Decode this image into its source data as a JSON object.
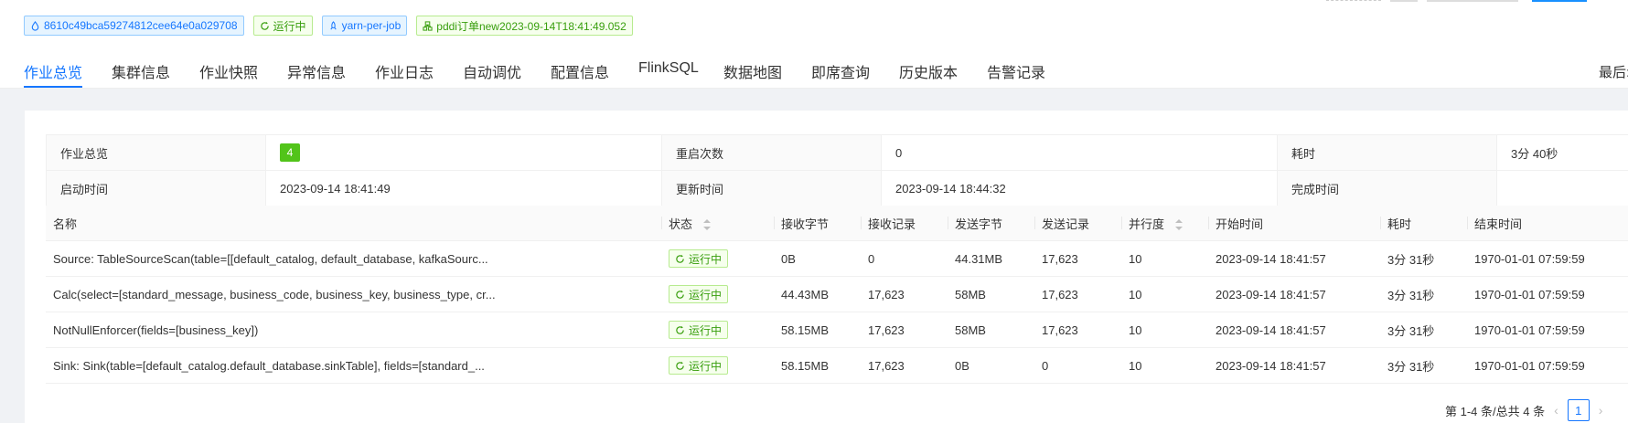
{
  "colors": {
    "accent": "#1677ff",
    "success": "#52c41a",
    "tag_green": "#389e0d"
  },
  "tags": [
    {
      "icon": "drop-icon",
      "text": "8610c49bca59274812cee64e0a029708",
      "style": "blue"
    },
    {
      "icon": "sync-icon",
      "text": "运行中",
      "style": "green"
    },
    {
      "icon": "rocket-icon",
      "text": "yarn-per-job",
      "style": "blue"
    },
    {
      "icon": "cluster-icon",
      "text": "pddi订单new2023-09-14T18:41:49.052",
      "style": "green"
    }
  ],
  "tabs": [
    "作业总览",
    "集群信息",
    "作业快照",
    "异常信息",
    "作业日志",
    "自动调优",
    "配置信息",
    "FlinkSQL",
    "数据地图",
    "即席查询",
    "历史版本",
    "告警记录"
  ],
  "active_tab": "作业总览",
  "tab_right": "最后:",
  "overview": {
    "row1": {
      "l1": "作业总览",
      "v1": "4",
      "l2": "重启次数",
      "v2": "0",
      "l3": "耗时",
      "v3": "3分 40秒"
    },
    "row2": {
      "l1": "启动时间",
      "v1": "2023-09-14 18:41:49",
      "l2": "更新时间",
      "v2": "2023-09-14 18:44:32",
      "l3": "完成时间",
      "v3": ""
    }
  },
  "vertex_table": {
    "columns": [
      "名称",
      "状态",
      "接收字节",
      "接收记录",
      "发送字节",
      "发送记录",
      "并行度",
      "开始时间",
      "耗时",
      "结束时间"
    ],
    "rows": [
      {
        "name": "Source: TableSourceScan(table=[[default_catalog, default_database, kafkaSourc...",
        "status": "运行中",
        "recv_bytes": "0B",
        "recv_records": "0",
        "send_bytes": "44.31MB",
        "send_records": "17,623",
        "parallelism": "10",
        "start": "2023-09-14 18:41:57",
        "duration": "3分 31秒",
        "end": "1970-01-01 07:59:59"
      },
      {
        "name": "Calc(select=[standard_message, business_code, business_key, business_type, cr...",
        "status": "运行中",
        "recv_bytes": "44.43MB",
        "recv_records": "17,623",
        "send_bytes": "58MB",
        "send_records": "17,623",
        "parallelism": "10",
        "start": "2023-09-14 18:41:57",
        "duration": "3分 31秒",
        "end": "1970-01-01 07:59:59"
      },
      {
        "name": "NotNullEnforcer(fields=[business_key])",
        "status": "运行中",
        "recv_bytes": "58.15MB",
        "recv_records": "17,623",
        "send_bytes": "58MB",
        "send_records": "17,623",
        "parallelism": "10",
        "start": "2023-09-14 18:41:57",
        "duration": "3分 31秒",
        "end": "1970-01-01 07:59:59"
      },
      {
        "name": "Sink: Sink(table=[default_catalog.default_database.sinkTable], fields=[standard_...",
        "status": "运行中",
        "recv_bytes": "58.15MB",
        "recv_records": "17,623",
        "send_bytes": "0B",
        "send_records": "0",
        "parallelism": "10",
        "start": "2023-09-14 18:41:57",
        "duration": "3分 31秒",
        "end": "1970-01-01 07:59:59"
      }
    ]
  },
  "pagination": {
    "summary": "第 1-4 条/总共 4 条",
    "prev": "‹",
    "current": "1",
    "next": "›"
  }
}
